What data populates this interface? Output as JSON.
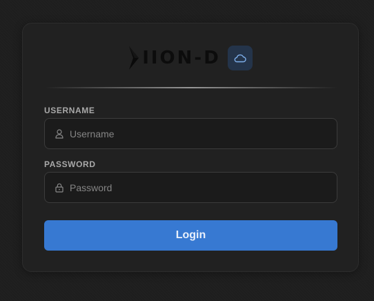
{
  "brand": {
    "logo_text": "IION-D",
    "cloud_icon": "cloud-icon"
  },
  "form": {
    "username": {
      "label": "USERNAME",
      "placeholder": "Username",
      "value": "",
      "icon": "user-icon"
    },
    "password": {
      "label": "PASSWORD",
      "placeholder": "Password",
      "value": "",
      "icon": "lock-icon"
    },
    "submit_label": "Login"
  },
  "colors": {
    "background": "#1e1e1e",
    "card": "#212121",
    "accent": "#3779d2",
    "badge": "#24344a"
  }
}
